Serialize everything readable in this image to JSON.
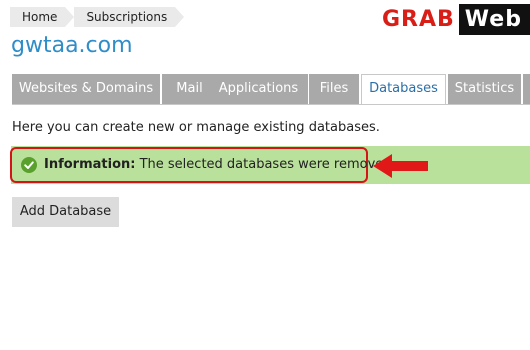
{
  "breadcrumb": {
    "items": [
      "Home",
      "Subscriptions"
    ]
  },
  "logo": {
    "part1": "GRAB",
    "part2": "Web"
  },
  "domain": {
    "title": "gwtaa.com"
  },
  "tabs": {
    "items": [
      "Websites & Domains",
      "Mail",
      "Applications",
      "Files",
      "Databases",
      "Statistics"
    ],
    "active": "Databases"
  },
  "intro": {
    "text": "Here you can create new or manage existing databases."
  },
  "message": {
    "label": "Information:",
    "text": " The selected databases were removed."
  },
  "toolbar": {
    "add_label": "Add Database"
  },
  "colors": {
    "accent": "#2f8dc8",
    "success_bg": "#b9e19b",
    "highlight": "#d51515",
    "tab_bg": "#a9a9a9"
  }
}
